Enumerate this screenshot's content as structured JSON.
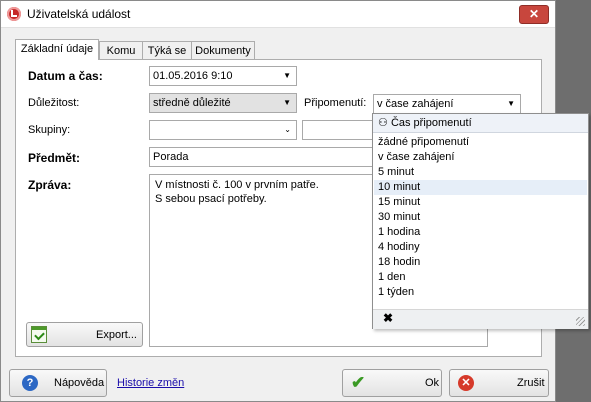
{
  "window": {
    "title": "Uživatelská událost"
  },
  "tabs": [
    {
      "label": "Základní údaje"
    },
    {
      "label": "Komu"
    },
    {
      "label": "Týká se"
    },
    {
      "label": "Dokumenty"
    }
  ],
  "form": {
    "datetime": {
      "label": "Datum a čas:",
      "value": "01.05.2016 9:10"
    },
    "importance": {
      "label": "Důležitost:",
      "value": "středně důležité"
    },
    "reminder": {
      "label": "Připomenutí:",
      "value": "v čase zahájení"
    },
    "groups": {
      "label": "Skupiny:",
      "value": "",
      "value2": ""
    },
    "subject": {
      "label": "Předmět:",
      "value": "Porada"
    },
    "message": {
      "label": "Zpráva:",
      "line1": "V místnosti č. 100 v prvním patře.",
      "line2": "S sebou psací potřeby."
    }
  },
  "dropdown": {
    "header": "Čas připomenutí",
    "items": [
      "žádné připomenutí",
      "v čase zahájení",
      "5 minut",
      "10 minut",
      "15 minut",
      "30 minut",
      "1 hodina",
      "4 hodiny",
      "18 hodin",
      "1 den",
      "1 týden"
    ],
    "selected": "10 minut",
    "close_glyph": "✖"
  },
  "buttons": {
    "export": "Export...",
    "help": "Nápověda",
    "history": "Historie změn",
    "ok": "Ok",
    "cancel": "Zrušit"
  },
  "icons": {
    "app": "app-icon",
    "close": "close-icon",
    "export": "export-icon",
    "help": "help-icon",
    "ok": "check-icon",
    "cancel": "cancel-icon",
    "dropdown_header": "binoculars-icon"
  }
}
